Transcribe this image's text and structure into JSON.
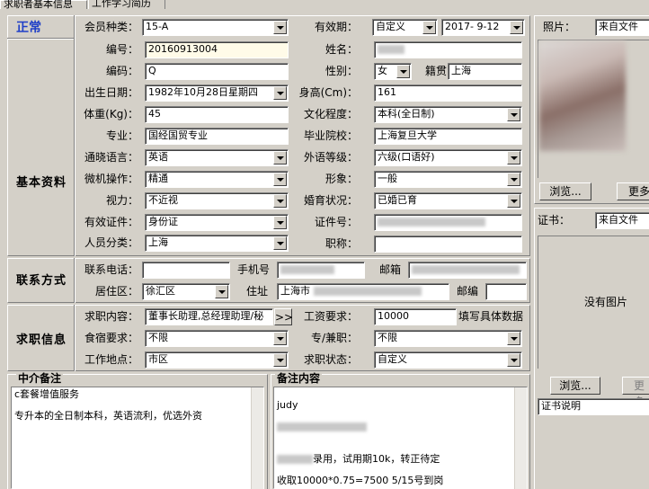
{
  "tabs": [
    "求职者基本信息",
    "工作学习简历"
  ],
  "status": "正常",
  "sections": {
    "basic": "基本资料",
    "contact": "联系方式",
    "job": "求职信息"
  },
  "form": {
    "member_type": {
      "label": "会员种类：",
      "value": "15-A"
    },
    "validity": {
      "label": "有效期：",
      "mode": "自定义",
      "date": "2017- 9-12"
    },
    "number": {
      "label": "编号：",
      "value": "20160913004"
    },
    "name": {
      "label": "姓名："
    },
    "code": {
      "label": "编码：",
      "value": "Q"
    },
    "gender": {
      "label": "性别：",
      "value": "女"
    },
    "native_place": {
      "label": "籍贯",
      "value": "上海"
    },
    "birthdate": {
      "label": "出生日期：",
      "value": "1982年10月28日星期四"
    },
    "height": {
      "label": "身高(Cm)：",
      "value": "161"
    },
    "weight": {
      "label": "体重(Kg)：",
      "value": "45"
    },
    "education": {
      "label": "文化程度：",
      "value": "本科(全日制)"
    },
    "major": {
      "label": "专业：",
      "value": "国经国贸专业"
    },
    "school": {
      "label": "毕业院校：",
      "value": "上海复旦大学"
    },
    "language": {
      "label": "通晓语言：",
      "value": "英语"
    },
    "foreign_level": {
      "label": "外语等级：",
      "value": "六级(口语好)"
    },
    "computer": {
      "label": "微机操作：",
      "value": "精通"
    },
    "appearance": {
      "label": "形象：",
      "value": "一般"
    },
    "vision": {
      "label": "视力：",
      "value": "不近视"
    },
    "marital": {
      "label": "婚育状况：",
      "value": "已婚已育"
    },
    "id_type": {
      "label": "有效证件：",
      "value": "身份证"
    },
    "id_number": {
      "label": "证件号："
    },
    "person_class": {
      "label": "人员分类：",
      "value": "上海"
    },
    "title": {
      "label": "职称："
    }
  },
  "contact": {
    "phone": {
      "label": "联系电话："
    },
    "mobile": {
      "label": "手机号"
    },
    "email": {
      "label": "邮箱"
    },
    "district": {
      "label": "居住区：",
      "value": "徐汇区"
    },
    "address": {
      "label": "住址",
      "value": "上海市"
    },
    "postcode": {
      "label": "邮编"
    }
  },
  "job": {
    "content": {
      "label": "求职内容：",
      "value": "董事长助理,总经理助理/秘",
      "more": ">>"
    },
    "salary": {
      "label": "工资要求：",
      "value": "10000",
      "hint": "填写具体数据"
    },
    "meals": {
      "label": "食宿要求：",
      "value": "不限"
    },
    "fulltime": {
      "label": "专/兼职：",
      "value": "不限"
    },
    "location": {
      "label": "工作地点：",
      "value": "市区"
    },
    "status": {
      "label": "求职状态：",
      "value": "自定义"
    }
  },
  "notes": {
    "agency_title": "中介备注",
    "agency_text": "c套餐增值服务\n\n专升本的全日制本科，英语流利，优选外资",
    "remark_title": "备注内容",
    "remark_line1": "judy",
    "remark_line2": "录用，试用期10k，转正待定",
    "remark_line3": "收取10000*0.75=7500 5/15号到岗"
  },
  "side": {
    "photo_label": "照片：",
    "photo_source": "来自文件",
    "browse": "浏览...",
    "more": "更多",
    "cert_label": "证书：",
    "cert_source": "来自文件",
    "no_image": "没有图片",
    "browse2": "浏览...",
    "more2": "更多",
    "cert_desc": "证书说明"
  }
}
